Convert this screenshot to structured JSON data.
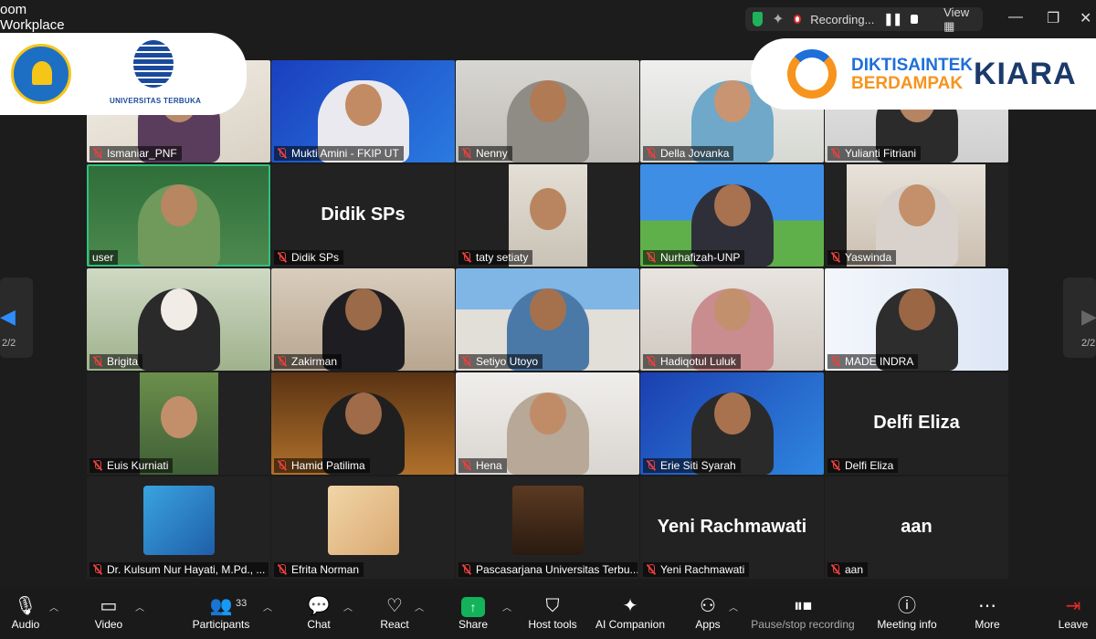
{
  "window": {
    "app_name_line1": "oom",
    "app_name_line2": "Workplace",
    "recording_label": "Recording...",
    "view_label": "View",
    "minimize": "—",
    "restore": "❐",
    "close": "✕"
  },
  "banners": {
    "left_ut_text": "UNIVERSITAS TERBUKA",
    "right_line1": "DIKTISAINTEK",
    "right_line2": "BERDAMPAK",
    "right_kiara": "KIARA"
  },
  "participants": [
    {
      "name": "Ismaniar_PNF"
    },
    {
      "name": "Mukti Amini - FKIP UT"
    },
    {
      "name": "Nenny"
    },
    {
      "name": "Della Jovanka"
    },
    {
      "name": "Yulianti Fitriani"
    },
    {
      "name": "user"
    },
    {
      "name": "Didik SPs",
      "center_label": "Didik SPs"
    },
    {
      "name": "taty setiaty"
    },
    {
      "name": "Nurhafizah-UNP"
    },
    {
      "name": "Yaswinda"
    },
    {
      "name": "Brigita"
    },
    {
      "name": "Zakirman"
    },
    {
      "name": "Setiyo Utoyo"
    },
    {
      "name": "Hadiqotul Luluk"
    },
    {
      "name": "MADE INDRA"
    },
    {
      "name": "Euis Kurniati"
    },
    {
      "name": "Hamid Patilima"
    },
    {
      "name": "Hena"
    },
    {
      "name": "Erie Siti Syarah"
    },
    {
      "name": "Delfi Eliza",
      "center_label": "Delfi Eliza"
    },
    {
      "name": "Dr. Kulsum Nur Hayati, M.Pd., ..."
    },
    {
      "name": "Efrita Norman"
    },
    {
      "name": "Pascasarjana Universitas Terbu..."
    },
    {
      "name": "Yeni Rachmawati",
      "center_label": "Yeni Rachmawati"
    },
    {
      "name": "aan",
      "center_label": "aan"
    }
  ],
  "pager": {
    "left": "2/2",
    "right": "2/2"
  },
  "toolbar": {
    "audio": "Audio",
    "video": "Video",
    "participants": "Participants",
    "participants_count": "33",
    "chat": "Chat",
    "react": "React",
    "share": "Share",
    "host_tools": "Host tools",
    "ai_companion": "AI Companion",
    "apps": "Apps",
    "pause_stop_recording": "Pause/stop recording",
    "meeting_info": "Meeting info",
    "more": "More",
    "leave": "Leave"
  },
  "colors": {
    "active_speaker": "#2ec27e",
    "share_green": "#12b35b",
    "muted_red": "#e8413c",
    "leave_red": "#e02b2b"
  }
}
